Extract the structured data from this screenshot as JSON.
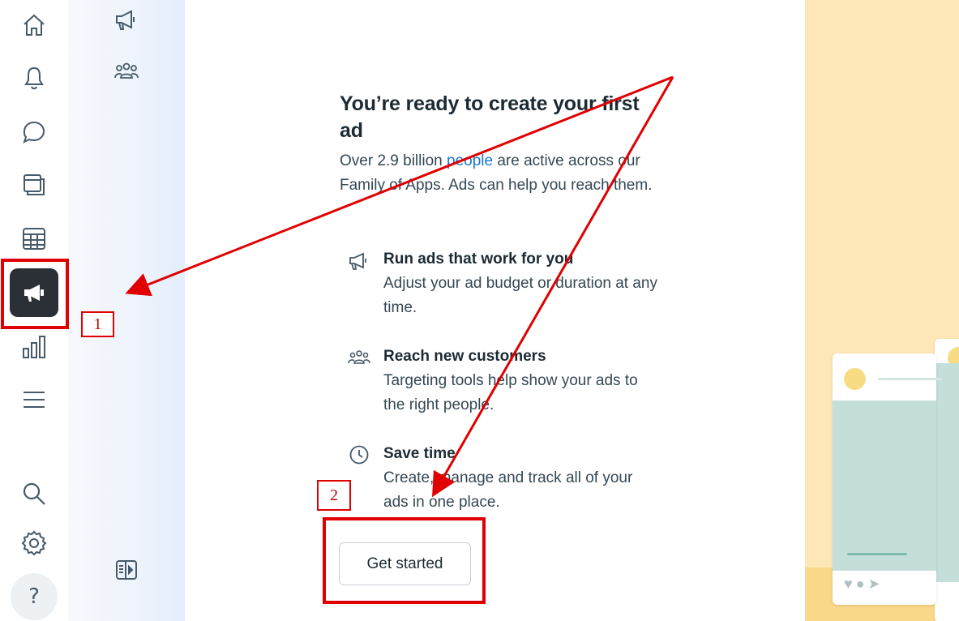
{
  "rail": {
    "items": [
      {
        "name": "home",
        "icon": "home-icon"
      },
      {
        "name": "notifications",
        "icon": "bell-icon"
      },
      {
        "name": "messages",
        "icon": "chat-icon"
      },
      {
        "name": "pages",
        "icon": "pages-icon"
      },
      {
        "name": "planner",
        "icon": "calendar-grid-icon"
      },
      {
        "name": "ads",
        "icon": "megaphone-icon",
        "active": true
      },
      {
        "name": "insights",
        "icon": "bar-chart-icon"
      },
      {
        "name": "all-tools",
        "icon": "menu-icon"
      }
    ],
    "bottom": [
      {
        "name": "search",
        "icon": "search-icon"
      },
      {
        "name": "settings",
        "icon": "gear-icon"
      },
      {
        "name": "help",
        "icon": "help-icon",
        "glyph": "?"
      }
    ]
  },
  "subnav": {
    "items": [
      {
        "name": "ads",
        "icon": "megaphone-icon"
      },
      {
        "name": "audiences",
        "icon": "people-icon"
      }
    ],
    "toggle_icon": "sidebar-collapse-icon"
  },
  "main": {
    "title": "You’re ready to create your first ad",
    "desc_before": "Over 2.9 billion ",
    "desc_link": "people",
    "desc_after": " are active across our Family of Apps. Ads can help you reach them.",
    "features": [
      {
        "icon": "megaphone-icon",
        "heading": "Run ads that work for you",
        "text": "Adjust your ad budget or duration at any time."
      },
      {
        "icon": "people-icon",
        "heading": "Reach new customers",
        "text": "Targeting tools help show your ads to the right people."
      },
      {
        "icon": "clock-icon",
        "heading": "Save time",
        "text": "Create, manage and track all of your ads in one place."
      }
    ],
    "cta_label": "Get started"
  },
  "annotations": {
    "label_1": "1",
    "label_2": "2",
    "color": "#e00000"
  },
  "colors": {
    "accent_link": "#1876d2",
    "active_rail": "#2b3036",
    "illustration_bg": "#fde7b6"
  }
}
